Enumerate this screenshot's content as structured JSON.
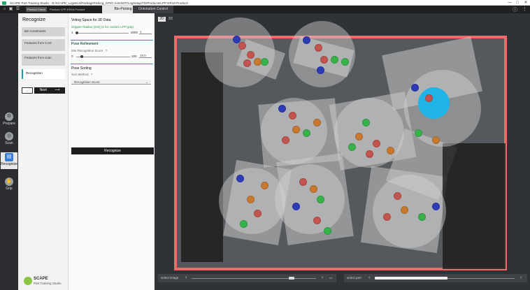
{
  "window": {
    "title": "SCAPE Part Training Studio - D:/SCAPE_Logistics/PackagePicking_KPI/C.min/SDT/LogSetup/TD/Products/LPP-KR16-Product/",
    "controls": [
      "—",
      "□",
      "✕"
    ]
  },
  "topbar": {
    "product_check": "Product Check",
    "product_name": "Product: LPP-KR16-Product",
    "tabs": [
      "Bin-Picking",
      "Orientation Control"
    ],
    "right_icons": [
      "ⓘ",
      "⋮"
    ]
  },
  "rail": [
    {
      "label": "Prepare",
      "icon": "prepare-icon"
    },
    {
      "label": "Scan",
      "icon": "scan-icon"
    },
    {
      "label": "Recognize",
      "icon": "recognize-icon"
    },
    {
      "label": "Grip",
      "icon": "grip-icon"
    }
  ],
  "steps": {
    "title": "Recognize",
    "items": [
      "Bin Constraints",
      "Features from CAD",
      "Features from scan",
      "Recognition"
    ],
    "back": "←",
    "next": "Next"
  },
  "params": {
    "voting": {
      "title": "Voting Space for 3D Data",
      "gripper_label": "Gripper Radius [mm] (1 for custom LPP grip)",
      "min": "1",
      "max": "2000",
      "value": "1",
      "fraction": 0.0
    },
    "pose": {
      "title": "Pose Refinement",
      "min_label": "Min Recognition Score",
      "help": "?",
      "min": "0",
      "max": "100",
      "value": "10.0",
      "fraction": 0.1
    },
    "sorting": {
      "title": "Pose Sorting",
      "method_label": "Sort Method",
      "method_value": "Recognition Score"
    },
    "recognize_button": "Recognize"
  },
  "viewer": {
    "view_tabs": [
      "2D",
      "3D"
    ],
    "select_image": "select image",
    "select_part": "select part",
    "image_position": 0.82,
    "part_position": 0.52
  },
  "brand": {
    "name": "SCAPE",
    "tagline": "Part Training Studio"
  }
}
